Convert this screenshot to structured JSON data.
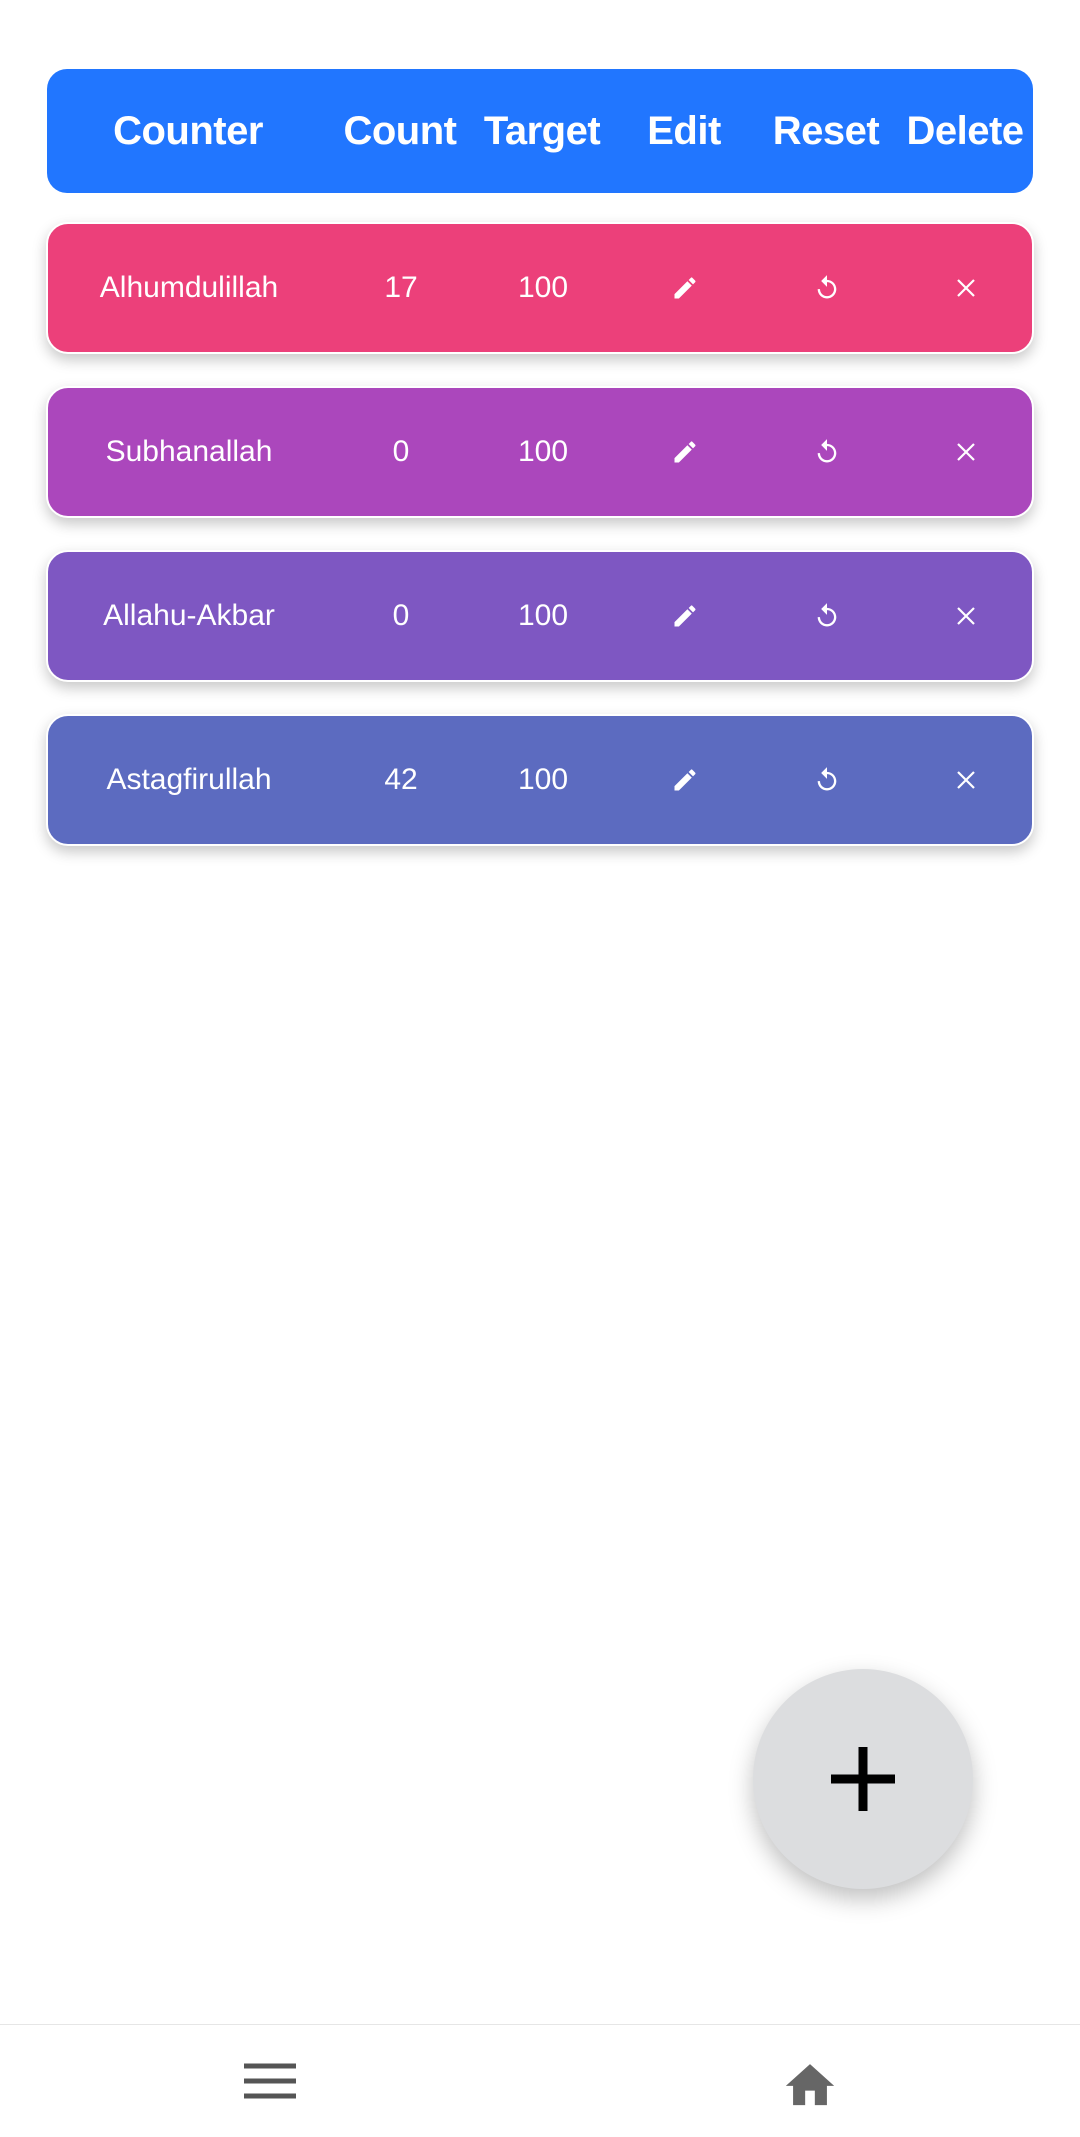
{
  "header": {
    "counter": "Counter",
    "count": "Count",
    "target": "Target",
    "edit": "Edit",
    "reset": "Reset",
    "delete": "Delete",
    "color": "#2176FF"
  },
  "counters": [
    {
      "name": "Alhumdulillah",
      "count": "17",
      "target": "100",
      "color": "#EC407A"
    },
    {
      "name": "Subhanallah",
      "count": "0",
      "target": "100",
      "color": "#AB47BC"
    },
    {
      "name": "Allahu-Akbar",
      "count": "0",
      "target": "100",
      "color": "#7E57C2"
    },
    {
      "name": "Astagfirullah",
      "count": "42",
      "target": "100",
      "color": "#5C6BC0"
    }
  ],
  "icons": {
    "edit": "edit-icon",
    "reset": "reset-icon",
    "delete": "close-icon",
    "fab": "plus-icon",
    "menu": "menu-icon",
    "home": "home-icon"
  }
}
